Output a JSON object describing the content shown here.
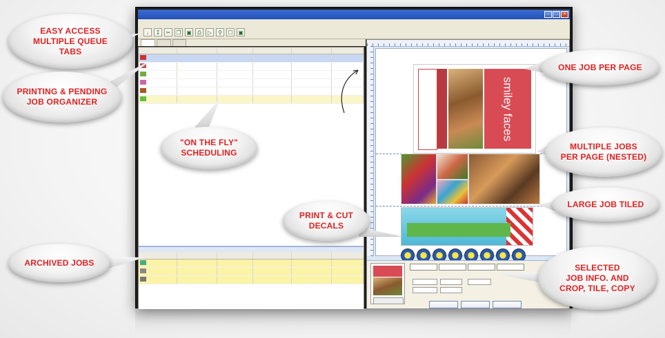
{
  "callouts": {
    "easy_access": "EASY ACCESS\nMULTIPLE QUEUE\nTABS",
    "printing_pending": "PRINTING & PENDING\nJOB ORGANIZER",
    "on_the_fly": "\"ON THE FLY\"\nSCHEDULING",
    "archived": "ARCHIVED JOBS",
    "one_job": "ONE JOB PER PAGE",
    "multiple_jobs": "MULTIPLE JOBS\nPER PAGE (NESTED)",
    "large_job": "LARGE JOB TILED",
    "print_cut": "PRINT & CUT\nDECALS",
    "selected": "SELECTED\nJOB INFO. AND\nCROP, TILE, COPY"
  },
  "preview": {
    "smiley_title": "smiley faces"
  },
  "colors": {
    "callout_text": "#e02020",
    "selected_row": "#c8d8f4",
    "archived_row": "#fbf3a6"
  }
}
